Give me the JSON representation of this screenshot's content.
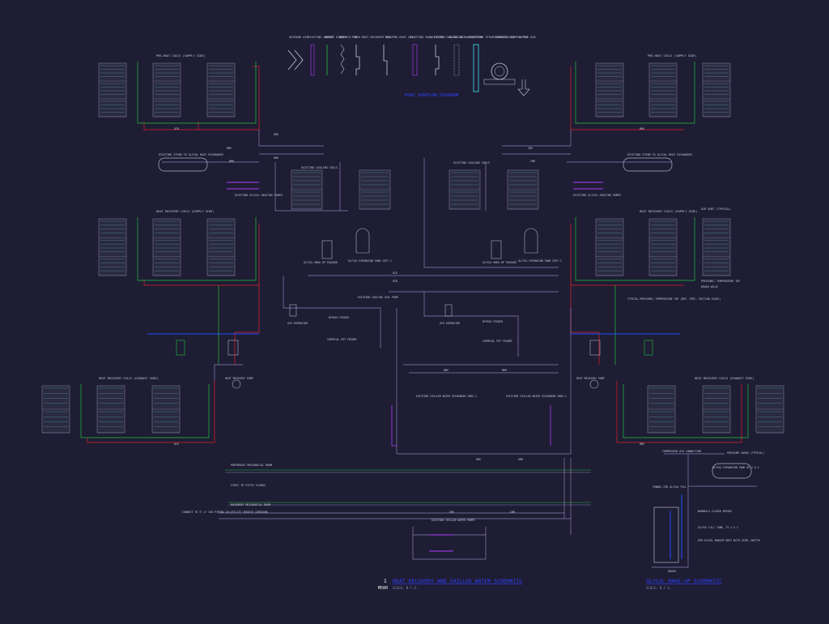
{
  "legend": {
    "items": [
      "OUTDOOR AIR",
      "EXISTING LOUVER",
      "INSECT SCREEN",
      "NEW FILTER",
      "NEW HEAT RECOVERY COIL",
      "NEW PRE-HEAT COIL",
      "EXISTING ROLL FILTER",
      "EXISTING COOLING COIL",
      "EXISTING HUMIDIFIER",
      "EXISTING STEAM REHEAT COIL",
      "EXISTING SUPPLY FAN",
      "SUPPLY AIR"
    ],
    "title": "HVAC AIRFLOW DIAGRAM"
  },
  "coil_labels": {
    "preheat": "PRE-HEAT COILS (SUPPLY SIDE)",
    "hr_supply": "HEAT RECOVERY COILS (SUPPLY SIDE)",
    "hr_exhaust": "HEAT RECOVERY COILS (EXHAUST SIDE)"
  },
  "equipment": {
    "steam_hx": "EXISTING STEAM TO GLYCOL HEAT EXCHANGER",
    "glycol_pumps": "EXISTING GLYCOL HEATING PUMPS",
    "cooling_coils_2": "EXISTING COOLING COILS",
    "cooling_coils_1": "EXISTING COOLING COILS",
    "glycol_makeup_2": "GLYCOL MAKE-UP PACKAGE",
    "glycol_makeup_1": "GLYCOL MAKE-UP PACKAGE",
    "exp_tank_2": "GLYCOL EXPANSION TANK CEET-2",
    "exp_tank_1": "GLYCOL EXPANSION TANK CEET-1",
    "air_sep_2": "AIR SEPARATOR",
    "air_sep_1": "AIR SEPARATOR",
    "cooling_pump": "EXISTING COOLING COIL PUMP",
    "bypass_2": "BYPASS FEEDER",
    "bypass_1": "BYPASS FEEDER",
    "chem_pot_2": "CHEMICAL POT FEEDER",
    "chem_pot_1": "CHEMICAL POT FEEDER",
    "hr_pump_l": "HEAT RECOVERY PUMP",
    "hr_pump_r": "HEAT RECOVERY PUMP",
    "chiller_hx_2": "EXISTING CHILLED WATER EXCHANGER CWHX-2",
    "chiller_hx_1": "EXISTING CHILLED WATER EXCHANGER CWHX-1",
    "chw_pumps": "EXISTING CHILLED WATER PUMPS",
    "air_vent": "AIR VENT (TYPICAL)",
    "pt_tap": "PRESSURE/ TEMPERATURE TAP",
    "drain_valve": "DRAIN VALVE",
    "typ_tap": "TYPICAL PRESSURE/ TEMPERATURE TAP (REF. SPEC. SECTION 15XXX)",
    "comp_air": "COMPRESSED AIR CONNECTION",
    "pressure_gauge": "PRESSURE GAUGE (TYPICAL)",
    "glycol_tank": "GLYCOL EXPANSION TANK GE-1 & 2",
    "funnel": "FUNNEL FOR GLYCOL FILL",
    "nc_bypass": "NORMALLY CLOSED BYPASS",
    "glycol_fill": "GLYCOL FILL TANK, TF-1 & 2",
    "gpd": "GPD GLYCOL MAKEUP UNIT WITH LEVEL SWITCH",
    "drain": "DRAIN"
  },
  "floors": {
    "penthouse": "PENTHOUSE MECHANICAL ROOM",
    "first_fifth": "FIRST TO FIFTH FLOORS",
    "basement": "BASEMENT MECHANICAL ROOM",
    "connect": "CONNECT TO 3\"-4\" DIA PIPING IN UTILITY SERVICE CORRIDOR"
  },
  "pipe_tags": [
    "HRS",
    "HRR",
    "GHS",
    "GHR",
    "CHS",
    "CHR",
    "GCS",
    "GCR"
  ],
  "titles": {
    "main": "HEAT RECOVERY AND CHILLED WATER SCHEMATIC",
    "main_scale": "SCALE: N.T.S.",
    "detail_num": "1",
    "detail_sheet": "M500",
    "right": "GLYCOL MAKE-UP SCHEMATIC",
    "right_scale": "SCALE: N.T.S."
  },
  "colors": {
    "bg": "#1e1d33",
    "line": "#8a7fb5",
    "supply": "#e0202a",
    "return": "#20c040",
    "cold": "#2050ff",
    "purple": "#b040ff",
    "cyan": "#40d0e0",
    "text": "#c8c8d8",
    "coil": "#506070",
    "title": "#3040ff"
  }
}
